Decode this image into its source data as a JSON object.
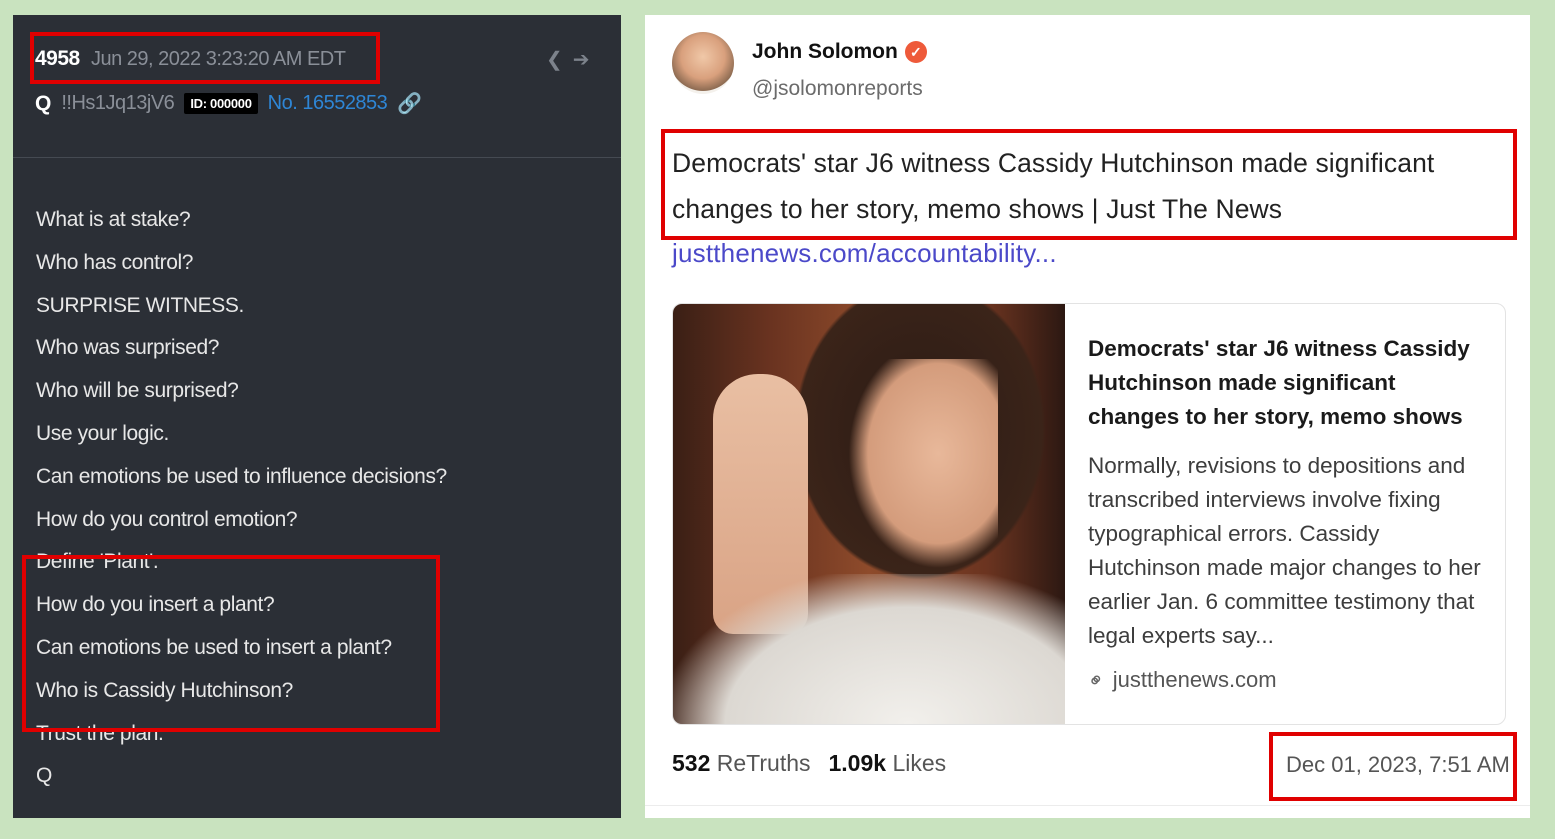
{
  "q_post": {
    "number": "4958",
    "date": "Jun 29, 2022 3:23:20 AM EDT",
    "name": "Q",
    "tripcode": "!!Hs1Jq13jV6",
    "id_badge": "ID: 000000",
    "post_no": "No. 16552853",
    "lines": [
      "What is at stake?",
      "Who has control?",
      "SURPRISE WITNESS.",
      "Who was surprised?",
      "Who will be surprised?",
      "Use your logic.",
      "Can emotions be used to influence decisions?",
      "How do you control emotion?",
      "Define 'Plant'.",
      "How do you insert a plant?",
      "Can emotions be used to insert a plant?",
      "Who is Cassidy Hutchinson?",
      "Trust the plan.",
      "Q"
    ],
    "icons": [
      "share-icon",
      "arrow-circle-icon",
      "link-icon"
    ]
  },
  "truth_post": {
    "author_name": "John Solomon",
    "handle": "@jsolomonreports",
    "text": "Democrats' star J6 witness Cassidy Hutchinson made significant changes to her story, memo shows | Just The News",
    "link": "justthenews.com/accountability...",
    "card": {
      "title": "Democrats' star J6 witness Cassidy Hutchinson made significant changes to her story, memo shows",
      "description": "Normally, revisions to depositions and transcribed interviews involve fixing typographical errors. Cassidy Hutchinson made major changes to her earlier Jan. 6 committee testimony that legal experts say...",
      "domain": "justthenews.com"
    },
    "retruths_count": "532",
    "retruths_label": "ReTruths",
    "likes_count": "1.09k",
    "likes_label": "Likes",
    "date": "Dec 01, 2023, 7:51 AM"
  },
  "colors": {
    "highlight": "#e00000",
    "background": "#c9e3bf",
    "q_panel": "#2b2f36",
    "q_link": "#2e86d6",
    "truth_link": "#4b49c9",
    "verified_badge": "#ee5a3a"
  }
}
